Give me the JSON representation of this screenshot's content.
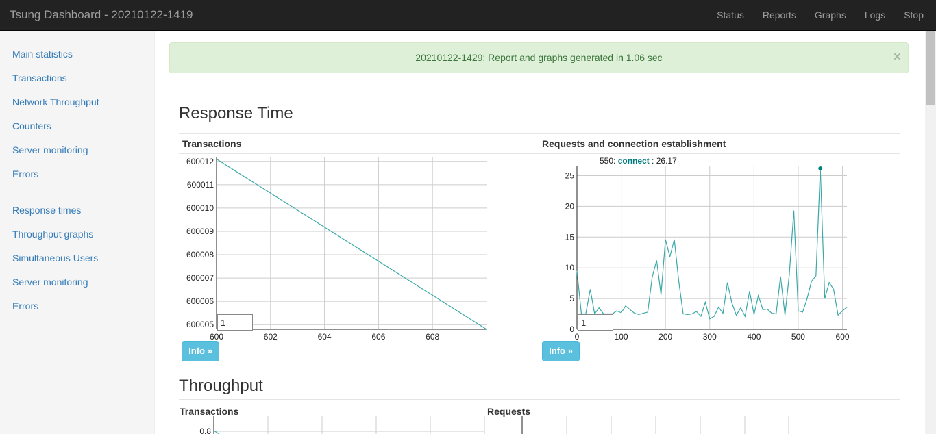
{
  "navbar": {
    "brand": "Tsung Dashboard - 20210122-1419",
    "links": [
      "Status",
      "Reports",
      "Graphs",
      "Logs",
      "Stop"
    ]
  },
  "sidebar": {
    "group1": [
      "Main statistics",
      "Transactions",
      "Network Throughput",
      "Counters",
      "Server monitoring",
      "Errors"
    ],
    "group2": [
      "Response times",
      "Throughput graphs",
      "Simultaneous Users",
      "Server monitoring",
      "Errors"
    ]
  },
  "alert": {
    "text": "20210122-1429: Report and graphs generated in 1.06 sec",
    "close": "×"
  },
  "sections": {
    "response_time": "Response Time",
    "throughput": "Throughput"
  },
  "panels": {
    "transactions_title": "Transactions",
    "requests_conn_title": "Requests and connection establishment",
    "throughput_transactions_title": "Transactions",
    "throughput_requests_title": "Requests",
    "info_label": "Info »",
    "roll_value": "1"
  },
  "hover": {
    "x": "550",
    "series": "connect",
    "value": "26.17"
  },
  "colors": {
    "line": "#3aa8a8",
    "navbar": "#222222",
    "link": "#337ab7",
    "info_button": "#5bc0de"
  },
  "chart_data": [
    {
      "type": "line",
      "title": "Transactions",
      "x_ticks": [
        600,
        602,
        604,
        606,
        608
      ],
      "y_ticks": [
        600005,
        600006,
        600007,
        600008,
        600009,
        600010,
        600011,
        600012
      ],
      "xlim": [
        600,
        610
      ],
      "ylim": [
        600004.8,
        600012.2
      ],
      "series": [
        {
          "x": [
            600,
            610
          ],
          "y": [
            600012.1,
            600004.8
          ]
        }
      ],
      "grid": true
    },
    {
      "type": "line",
      "title": "Requests and connection establishment",
      "x_ticks": [
        0,
        100,
        200,
        300,
        400,
        500,
        600
      ],
      "y_ticks": [
        0,
        5,
        10,
        15,
        20,
        25
      ],
      "xlim": [
        0,
        610
      ],
      "ylim": [
        0,
        26.5
      ],
      "grid": true,
      "series": [
        {
          "name": "connect",
          "x": [
            0,
            10,
            20,
            30,
            40,
            50,
            60,
            70,
            80,
            90,
            100,
            110,
            120,
            130,
            140,
            150,
            160,
            170,
            180,
            190,
            200,
            210,
            220,
            230,
            240,
            250,
            260,
            270,
            280,
            290,
            300,
            310,
            320,
            330,
            340,
            350,
            360,
            370,
            380,
            390,
            400,
            410,
            420,
            430,
            440,
            450,
            460,
            470,
            480,
            490,
            500,
            510,
            520,
            530,
            540,
            550,
            560,
            570,
            580,
            590,
            600,
            610
          ],
          "y": [
            9.5,
            2.5,
            2.5,
            6.5,
            2.5,
            3.5,
            2.5,
            2.5,
            2.5,
            3,
            2.7,
            3.8,
            3.2,
            2.6,
            2.4,
            2.6,
            2.8,
            8.5,
            11.2,
            5.6,
            14.6,
            11.8,
            14.6,
            7.8,
            2.5,
            2.4,
            2.5,
            2.9,
            2.1,
            4.4,
            1.7,
            2.1,
            3.6,
            2.6,
            7.6,
            4.3,
            2.3,
            3.5,
            2.1,
            6.2,
            2.4,
            5.5,
            3.2,
            3.3,
            2.6,
            2.5,
            8.6,
            2.3,
            9,
            19.3,
            3,
            2.8,
            5,
            7.8,
            8.7,
            26.17,
            5,
            7.6,
            6.5,
            2.3,
            3,
            3.6
          ]
        }
      ]
    }
  ]
}
